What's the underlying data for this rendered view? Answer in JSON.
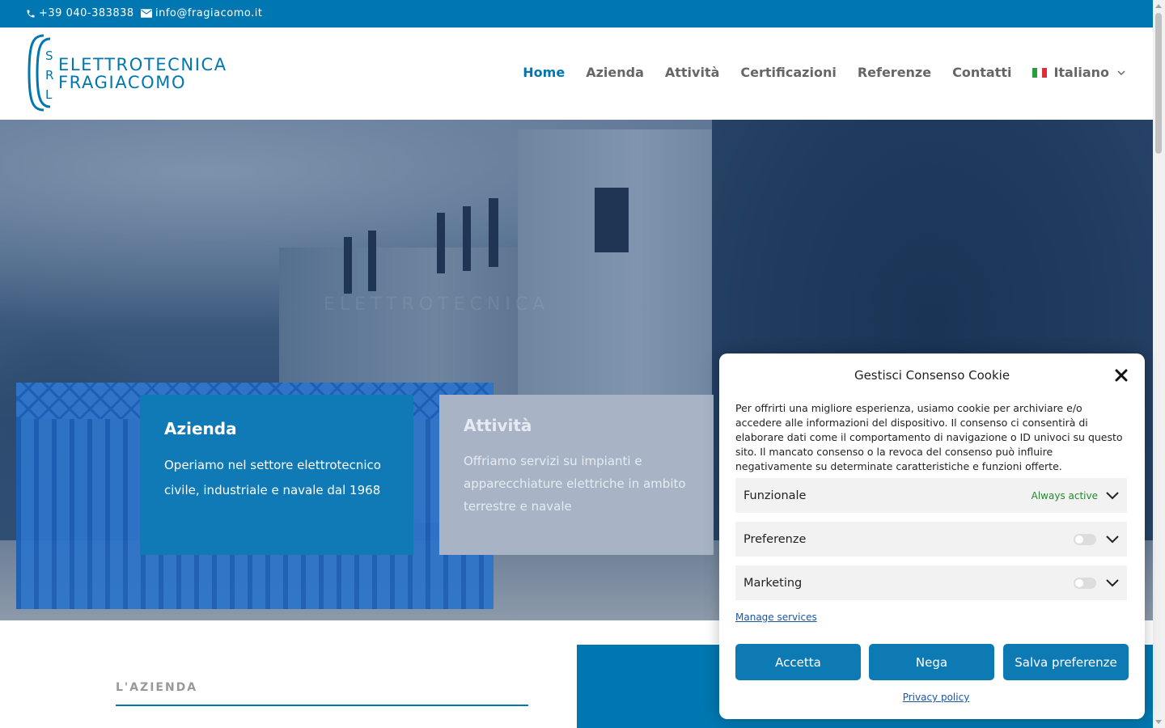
{
  "topbar": {
    "phone": "+39 040-383838",
    "email": "info@fragiacomo.it",
    "background": "#0077b0"
  },
  "logo": {
    "line1": "ELETTROTECNICA",
    "line2": "FRAGIACOMO",
    "letters": [
      "S",
      "R",
      "L"
    ]
  },
  "nav": {
    "items": [
      "Home",
      "Azienda",
      "Attività",
      "Certificazioni",
      "Referenze",
      "Contatti"
    ],
    "active": "Home",
    "language": "Italiano"
  },
  "hero": {
    "cards": [
      {
        "title": "Azienda",
        "text": "Operiamo nel settore elettrotecnico civile, industriale e navale dal 1968"
      },
      {
        "title": "Attività",
        "text": "Offriamo servizi su impianti e apparecchiature elettriche in ambito terrestre e navale"
      }
    ],
    "watermark": "ELETTROTECNICA"
  },
  "section": {
    "about_title": "L'AZIENDA"
  },
  "cookie": {
    "title": "Gestisci Consenso Cookie",
    "description": "Per offrirti una migliore esperienza, usiamo cookie per archiviare e/o accedere alle informazioni del dispositivo. Il consenso ci consentirà di elaborare dati come il comportamento di navigazione o ID univoci su questo sito. Il mancato consenso o la revoca del consenso può influire negativamente su determinate caratteristiche e funzioni offerte.",
    "categories": [
      {
        "label": "Funzionale",
        "status": "Always active"
      },
      {
        "label": "Preferenze",
        "status": ""
      },
      {
        "label": "Marketing",
        "status": ""
      }
    ],
    "manage_services": "Manage services",
    "buttons": {
      "accept": "Accetta",
      "deny": "Nega",
      "save": "Salva preferenze"
    },
    "privacy_policy": "Privacy policy",
    "accent": "#0e7ab4",
    "active_color": "#1e8b2b"
  }
}
